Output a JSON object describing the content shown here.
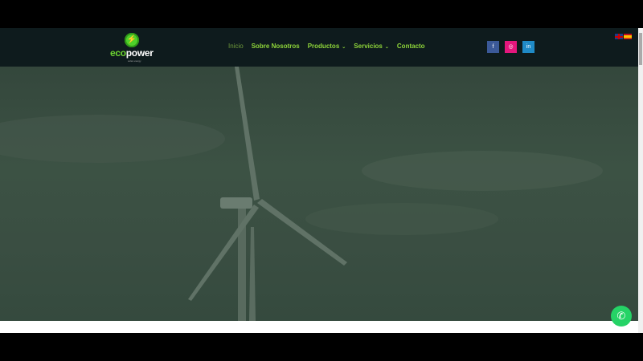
{
  "logo": {
    "text_eco": "eco",
    "text_power": "power",
    "tagline": "solar energy"
  },
  "nav": {
    "items": [
      {
        "label": "Inicio",
        "active": true
      },
      {
        "label": "Sobre Nosotros"
      },
      {
        "label": "Productos",
        "dropdown": true
      },
      {
        "label": "Servicios",
        "dropdown": true
      },
      {
        "label": "Contacto"
      }
    ]
  },
  "social": [
    {
      "name": "facebook",
      "color": "#3b5998"
    },
    {
      "name": "instagram",
      "color": "#e4177d"
    },
    {
      "name": "linkedin",
      "color": "#1f8ac6"
    }
  ],
  "languages": [
    "en",
    "es"
  ],
  "colors": {
    "header": "#0e1b1d",
    "accent": "#8fd63a",
    "whatsapp": "#25d366"
  }
}
